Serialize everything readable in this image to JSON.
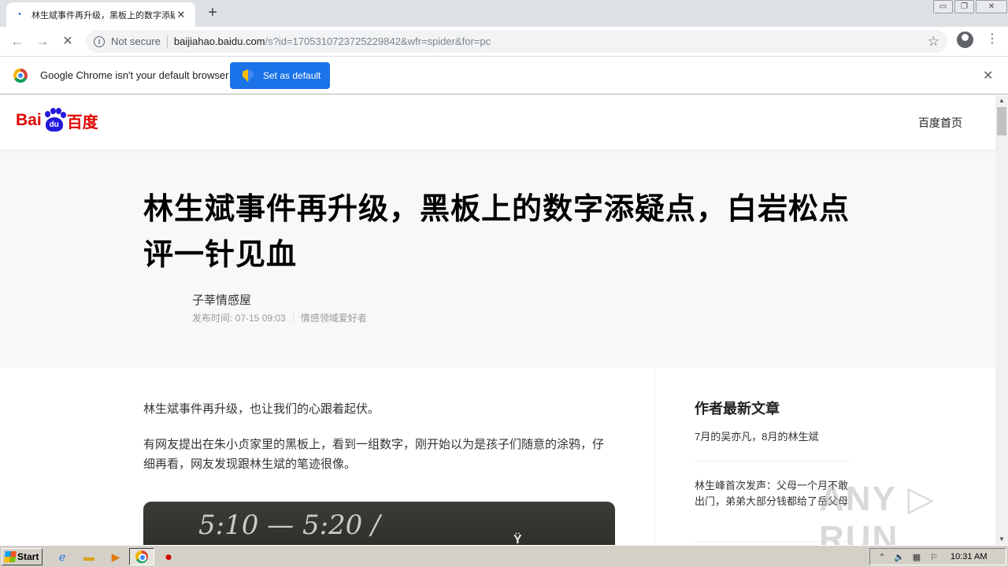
{
  "browser": {
    "tab_title": "林生斌事件再升级，黑板上的数字添疑点",
    "new_tab": "+",
    "close": "✕",
    "url_security": "Not secure",
    "url_host": "baijiahao.baidu.com",
    "url_path": "/s?id=1705310723725229842&wfr=spider&for=pc",
    "infobar_text": "Google Chrome isn't your default browser",
    "set_default_label": "Set as default"
  },
  "site": {
    "logo_bai": "Bai",
    "logo_du": "du",
    "logo_cn": "百度",
    "home_link": "百度首页"
  },
  "article": {
    "title": "林生斌事件再升级，黑板上的数字添疑点，白岩松点评一针见血",
    "author": "子莘情感屋",
    "published": "发布时间: 07-15  09:03",
    "author_tag": "情感领域爱好者",
    "paragraphs": [
      "林生斌事件再升级，也让我们的心跟着起伏。",
      "有网友提出在朱小贞家里的黑板上，看到一组数字，刚开始以为是孩子们随意的涂鸦，仔细再看，网友发现跟林生斌的笔迹很像。"
    ],
    "image_chalk": "5:10 — 5:20 /",
    "image_logo": "Ÿ"
  },
  "sidebar": {
    "title": "作者最新文章",
    "items": [
      "7月的吴亦凡，8月的林生斌",
      "林生峰首次发声：父母一个月不敢出门，弟弟大部分钱都给了岳父母"
    ]
  },
  "watermark": "ANY ▷ RUN",
  "taskbar": {
    "start_label": "Start",
    "clock": "10:31 AM"
  },
  "colors": {
    "accent": "#1a73e8",
    "baidu_red": "#e10601",
    "baidu_blue": "#2319dc"
  }
}
